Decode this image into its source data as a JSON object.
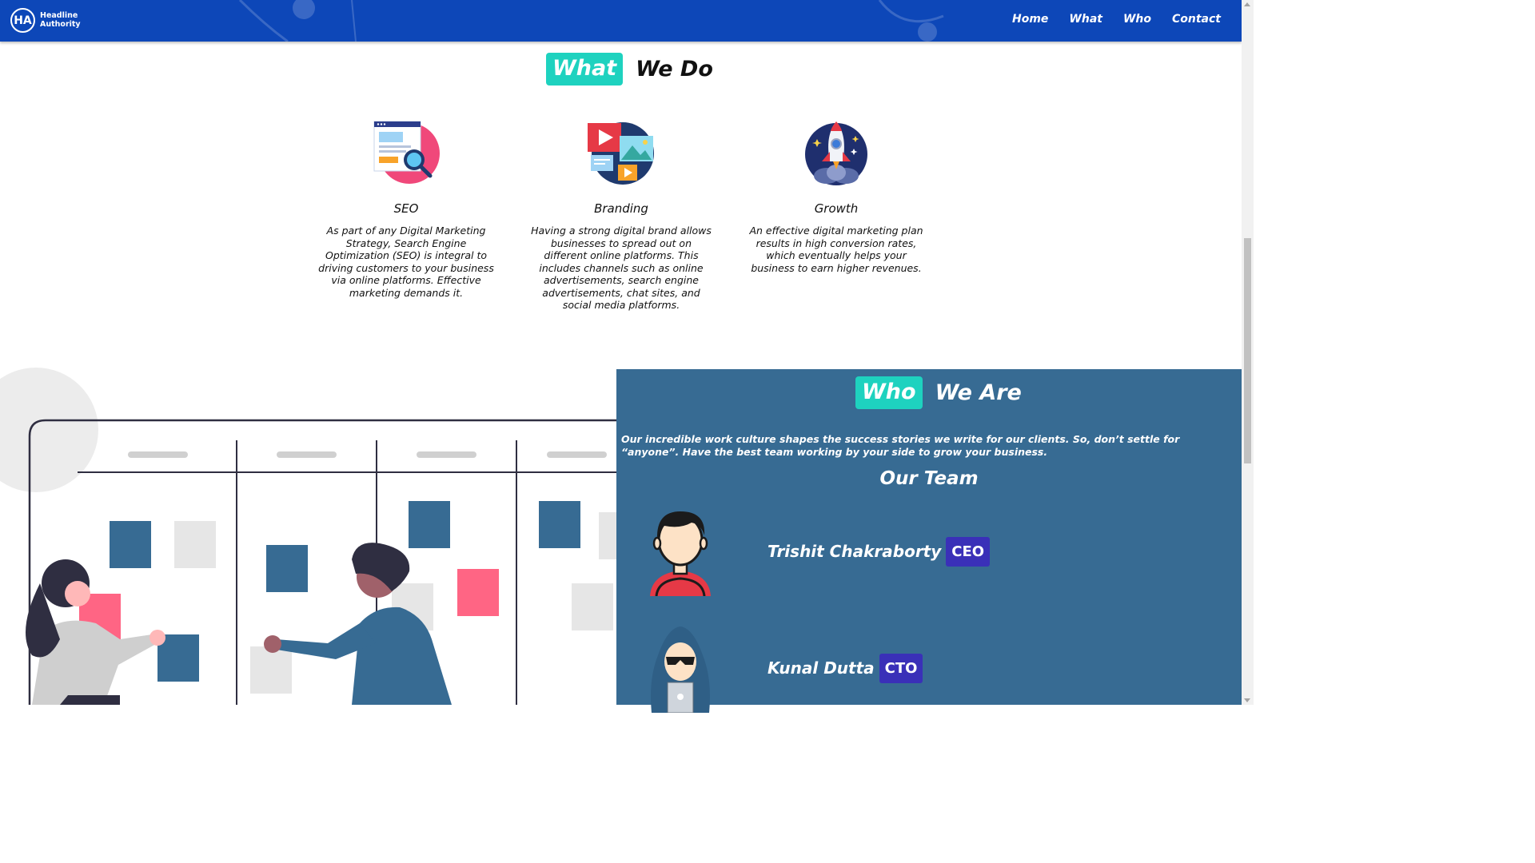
{
  "nav": {
    "logo_mark": "HA",
    "logo_line1": "Headline",
    "logo_line2": "Authority",
    "links": [
      "Home",
      "What",
      "Who",
      "Contact"
    ]
  },
  "what": {
    "highlight": "What",
    "rest": "We Do",
    "services": [
      {
        "title": "SEO",
        "icon": "seo-search-icon",
        "text": "As part of any Digital Marketing Strategy, Search Engine Optimization (SEO) is integral to driving customers to your business via online platforms. Effective marketing demands it."
      },
      {
        "title": "Branding",
        "icon": "media-branding-icon",
        "text": "Having a strong digital brand allows businesses to spread out on different online platforms. This includes channels such as online advertisements, search engine advertisements, chat sites, and social media platforms."
      },
      {
        "title": "Growth",
        "icon": "rocket-icon",
        "text": "An effective digital marketing plan results in high conversion rates, which eventually helps your business to earn higher revenues."
      }
    ]
  },
  "who": {
    "highlight": "Who",
    "rest": "We Are",
    "description": "Our incredible work culture shapes the success stories we write for our clients. So, don’t settle for “anyone”. Have the best team working by your side to grow your business.",
    "team_heading": "Our Team",
    "members": [
      {
        "name": "Trishit Chakraborty",
        "role": "CEO"
      },
      {
        "name": "Kunal Dutta",
        "role": "CTO"
      }
    ]
  },
  "colors": {
    "nav_bg": "#0d47b8",
    "accent_teal": "#1ed2bf",
    "panel_blue": "#376b93",
    "badge_purple": "#3a30b8"
  }
}
